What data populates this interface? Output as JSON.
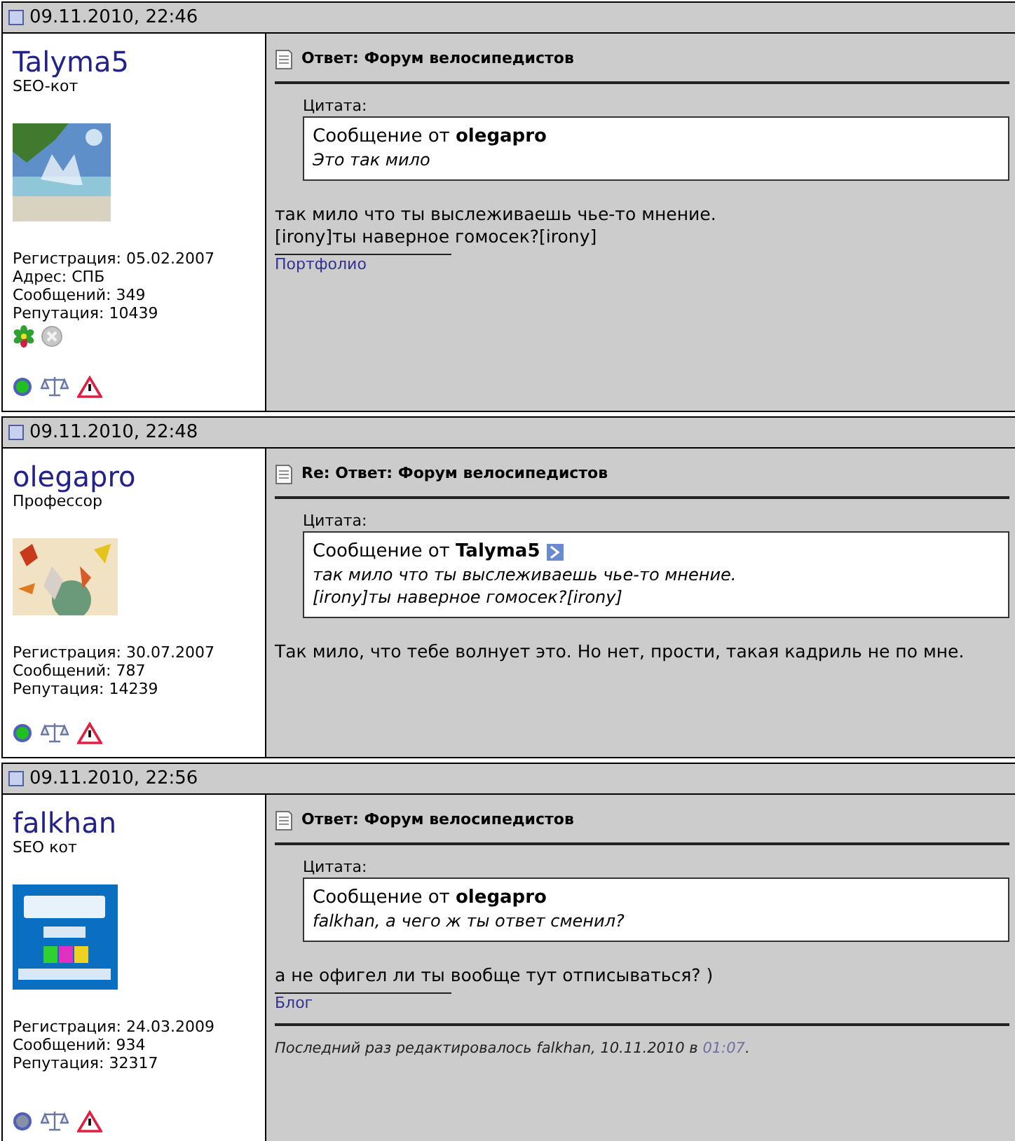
{
  "posts": [
    {
      "date": "09.11.2010, 22:46",
      "username": "Talyma5",
      "rank": "SEO-кот",
      "avatar": {
        "kind": "picture"
      },
      "info": [
        "Регистрация: 05.02.2007",
        "Адрес: СПБ",
        "Сообщений: 349",
        "Репутация: 10439"
      ],
      "contacts": [
        {
          "kind": "icq"
        },
        {
          "kind": "msn"
        }
      ],
      "online": true,
      "title": "Ответ: Форум велосипедистов",
      "quote": {
        "label": "Цитата:",
        "header": "Сообщение от **olegapro**",
        "view_link": false,
        "text": "Это так мило"
      },
      "body": "так мило что ты выслеживаешь чье-то мнение.\n[irony]ты наверное гомосек?[irony]",
      "signature": "Портфолио"
    },
    {
      "date": "09.11.2010, 22:48",
      "username": "olegapro",
      "rank": "Профессор",
      "avatar": {
        "kind": "picture"
      },
      "info": [
        "Регистрация: 30.07.2007",
        "Сообщений: 787",
        "Репутация: 14239"
      ],
      "online": true,
      "title": "Re: Ответ: Форум велосипедистов",
      "quote": {
        "label": "Цитата:",
        "header": "Сообщение от **Talyma5**",
        "view_link": true,
        "text": "так мило что ты выслеживаешь чье-то мнение.\n[irony]ты наверное гомосек?[irony]"
      },
      "body": "Так мило, что тебе волнует это. Но нет, прости, такая кадриль не по мне."
    },
    {
      "date": "09.11.2010, 22:56",
      "username": "falkhan",
      "rank": "SEO кот",
      "avatar": {
        "kind": "picture"
      },
      "info": [
        "Регистрация: 24.03.2009",
        "Сообщений: 934",
        "Репутация: 32317"
      ],
      "online": false,
      "title": "Ответ: Форум велосипедистов",
      "quote": {
        "label": "Цитата:",
        "header": "Сообщение от **olegapro**",
        "view_link": false,
        "text": "falkhan, а чего ж ты ответ сменил?"
      },
      "body": "а не офигел ли ты вообще тут отписываться? )",
      "signature": "Блог",
      "edit_note": {
        "text": "Последний раз редактировалось falkhan, 10.11.2010 в",
        "time": "01:07",
        "end": "."
      }
    }
  ]
}
